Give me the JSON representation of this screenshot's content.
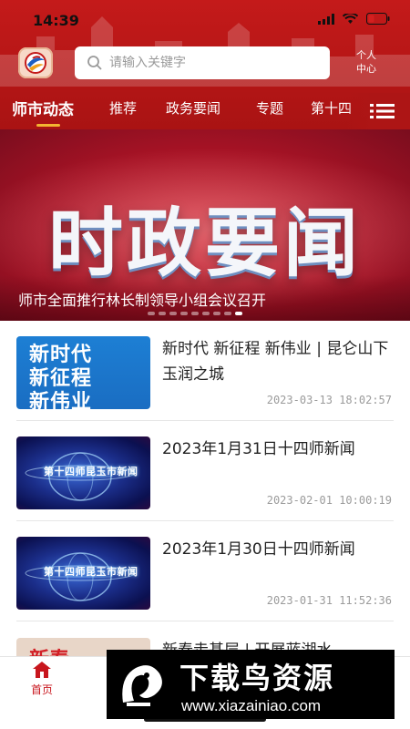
{
  "status_bar": {
    "time": "14:39"
  },
  "header": {
    "search_placeholder": "请输入关键字",
    "profile_line1": "个人",
    "profile_line2": "中心"
  },
  "tabs": [
    {
      "label": "师市动态",
      "active": true
    },
    {
      "label": "推荐",
      "active": false
    },
    {
      "label": "政务要闻",
      "active": false
    },
    {
      "label": "专题",
      "active": false
    },
    {
      "label": "第十四",
      "active": false
    }
  ],
  "banner": {
    "title": "时政要闻",
    "caption": "师市全面推行林长制领导小组会议召开",
    "slide_count": 9,
    "active_slide": 9
  },
  "news": [
    {
      "title": "新时代 新征程 新伟业 | 昆仑山下 玉润之城",
      "date": "2023-03-13 18:02:57",
      "thumb": {
        "lines": [
          "新时代",
          "新征程",
          "新伟业"
        ]
      }
    },
    {
      "title": "2023年1月31日十四师新闻",
      "date": "2023-02-01 10:00:19",
      "thumb": {
        "caption": "第十四师昆玉市新闻"
      }
    },
    {
      "title": "2023年1月30日十四师新闻",
      "date": "2023-01-31 11:52:36",
      "thumb": {
        "caption": "第十四师昆玉市新闻"
      }
    },
    {
      "title": "新春走基层 | 开展蓝湖水",
      "thumb": {
        "text": "新春"
      }
    }
  ],
  "bottom_nav": {
    "home_label": "首页"
  },
  "watermark": {
    "title": "下载鸟资源",
    "url": "www.xiazainiao.com"
  },
  "colors": {
    "primary_red": "#c41a1a",
    "tab_underline": "#f3b531",
    "home_active": "#c8161d"
  }
}
